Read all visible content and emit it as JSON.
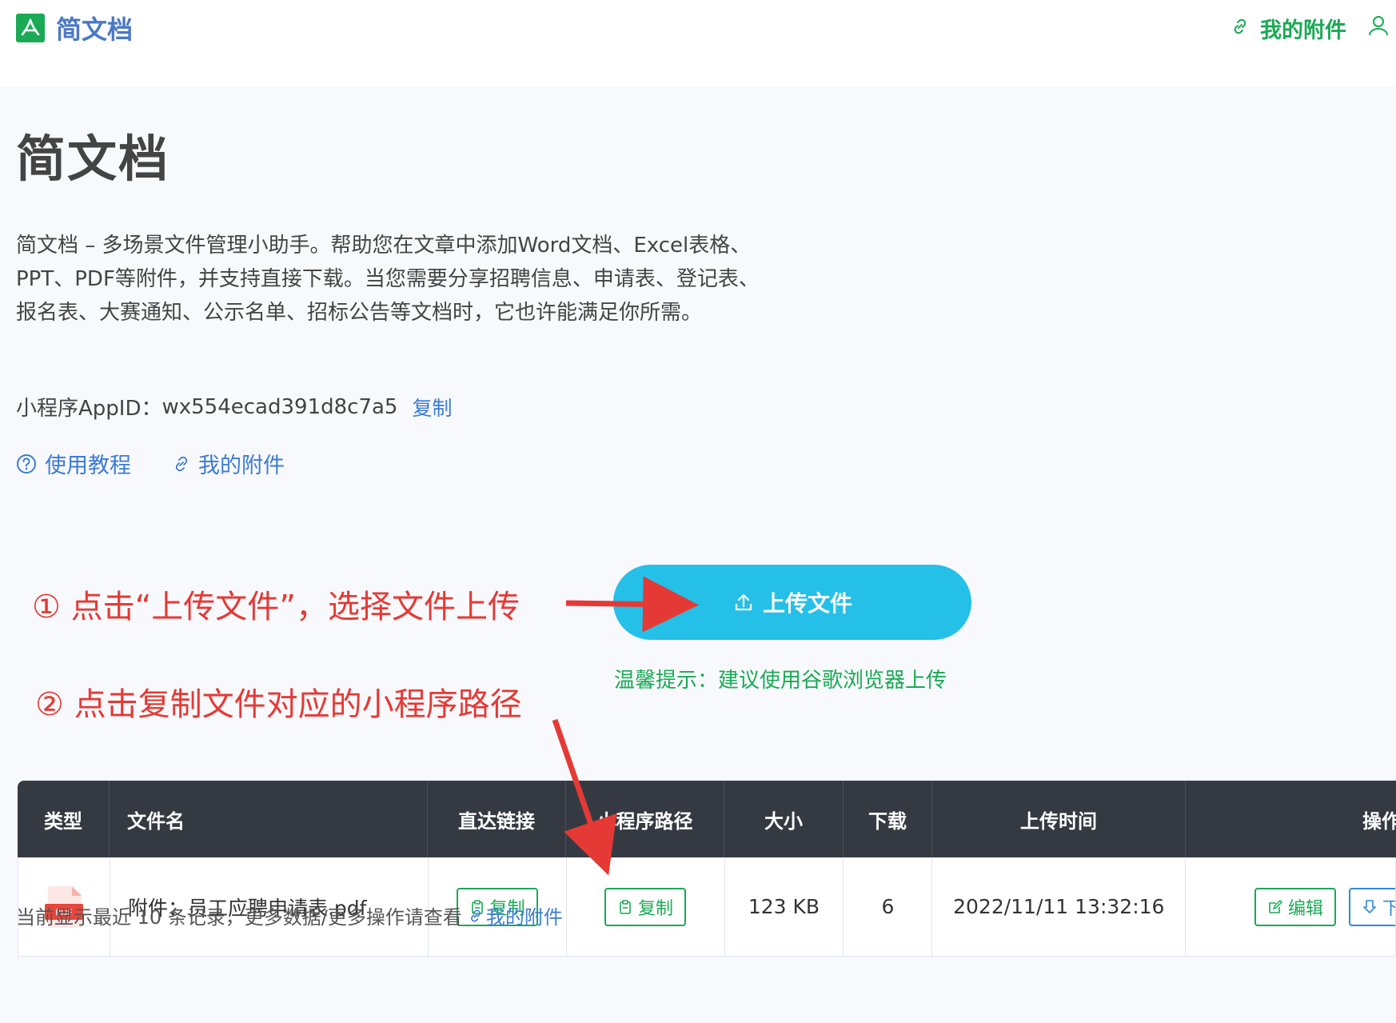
{
  "header": {
    "brand": "简文档",
    "my_attachments": "我的附件"
  },
  "page": {
    "title": "简文档",
    "description": "简文档 – 多场景文件管理小助手。帮助您在文章中添加Word文档、Excel表格、PPT、PDF等附件，并支持直接下载。当您需要分享招聘信息、申请表、登记表、报名表、大赛通知、公示名单、招标公告等文档时，它也许能满足你所需。",
    "appid_label": "小程序AppID：",
    "appid_value": "wx554ecad391d8c7a5",
    "appid_copy": "复制",
    "tutorial_link": "使用教程",
    "my_attachments_link": "我的附件"
  },
  "annotations": {
    "step1": "① 点击“上传文件”，选择文件上传",
    "step2": "② 点击复制文件对应的小程序路径"
  },
  "upload": {
    "button": "上传文件",
    "tip": "温馨提示：建议使用谷歌浏览器上传"
  },
  "table": {
    "headers": [
      "类型",
      "文件名",
      "直达链接",
      "小程序路径",
      "大小",
      "下载",
      "上传时间",
      "操作"
    ],
    "rows": [
      {
        "type_icon": "pdf-file-icon",
        "type_label": "PDF",
        "name": "附件：员工应聘申请表.pdf",
        "direct_copy": "复制",
        "mini_copy": "复制",
        "size": "123 KB",
        "downloads": "6",
        "uploaded": "2022/11/11 13:32:16",
        "edit": "编辑",
        "download": "下载"
      }
    ]
  },
  "footer": {
    "note": "当前显示最近 10 条记录，更多数据/更多操作请查看",
    "link": "我的附件"
  },
  "colors": {
    "brand_green": "#1aaa55",
    "link_blue": "#3b7bd4",
    "upload_cyan": "#25c0e8",
    "annotation_red": "#e53935",
    "table_header": "#353a42"
  }
}
